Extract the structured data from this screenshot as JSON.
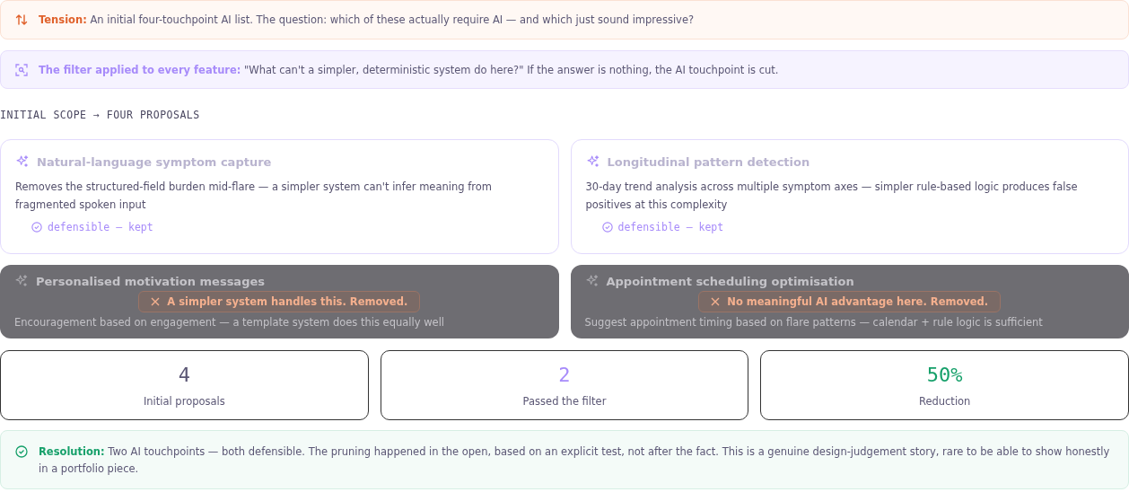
{
  "tension": {
    "label": "Tension:",
    "text": "An initial four-touchpoint AI list. The question: which of these actually require AI — and which just sound impressive?"
  },
  "filter": {
    "label": "The filter applied to every feature:",
    "text": "\"What can't a simpler, deterministic system do here?\" If the answer is nothing, the AI touchpoint is cut."
  },
  "section_heading": "INITIAL SCOPE → FOUR PROPOSALS",
  "proposals": [
    {
      "title": "Natural-language symptom capture",
      "description": "Removes the structured-field burden mid-flare — a simpler system can't infer meaning from fragmented spoken input",
      "kind": "kept",
      "verdict": "defensible — kept"
    },
    {
      "title": "Longitudinal pattern detection",
      "description": "30-day trend analysis across multiple symptom axes — simpler rule-based logic produces false positives at this complexity",
      "kind": "kept",
      "verdict": "defensible — kept"
    },
    {
      "title": "Personalised motivation messages",
      "description": "Encouragement based on engagement — a template system does this equally well",
      "kind": "removed",
      "verdict": "A simpler system handles this. Removed."
    },
    {
      "title": "Appointment scheduling optimisation",
      "description": "Suggest appointment timing based on flare patterns — calendar + rule logic is sufficient",
      "kind": "removed",
      "verdict": "No meaningful AI advantage here. Removed."
    }
  ],
  "stats": [
    {
      "value": "4",
      "label": "Initial proposals",
      "color": "#5b5775"
    },
    {
      "value": "2",
      "label": "Passed the filter",
      "color": "#a78bfa"
    },
    {
      "value": "50%",
      "label": "Reduction",
      "color": "#16a06a"
    }
  ],
  "resolution": {
    "label": "Resolution:",
    "text": "Two AI touchpoints — both defensible. The pruning happened in the open, based on an explicit test, not after the fact. This is a genuine design-judgement story, rare to be able to show honestly in a portfolio piece."
  }
}
